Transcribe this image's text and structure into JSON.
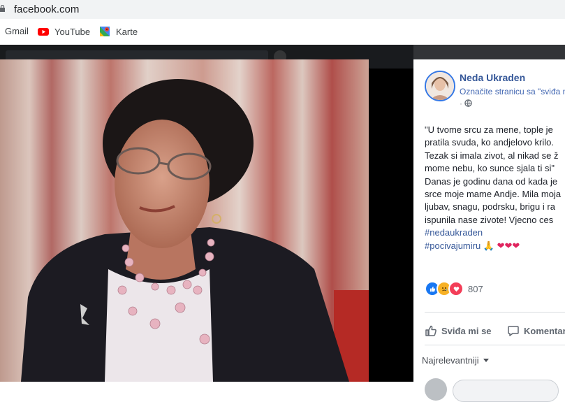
{
  "browser": {
    "url": "facebook.com",
    "bookmarks": [
      {
        "label": "Gmail",
        "icon": "gmail-icon"
      },
      {
        "label": "YouTube",
        "icon": "youtube-icon"
      },
      {
        "label": "Karte",
        "icon": "maps-icon"
      }
    ]
  },
  "post": {
    "author": "Neda Ukraden",
    "subtitle": "Označite stranicu sa \"sviđa mi se\"",
    "meta_separator": "·",
    "text_lines": [
      "\"U tvome srcu za mene, tople je",
      "pratila svuda, ko andjelovo krilo.",
      "Tezak si imala zivot, al nikad se ž",
      "mome nebu, ko sunce sjala ti si\"",
      "Danas je godinu dana od kada je",
      "srce moje mame Andje. Mila moja",
      "ljubav, snagu, podrsku, brigu i ra",
      "ispunila nase zivote! Vjecno ces"
    ],
    "hashtags": [
      "#nedaukraden",
      "#pocivajumiru"
    ],
    "hashtag_emoji": "🙏 ❤❤❤",
    "reaction_count": "807",
    "like_label": "Sviđa mi se",
    "comment_label": "Komentar",
    "sort_label": "Najrelevantniji"
  },
  "colors": {
    "link": "#365899",
    "like_blue": "#1877f2",
    "love_red": "#f33e58",
    "sad_yellow": "#f7b125"
  }
}
